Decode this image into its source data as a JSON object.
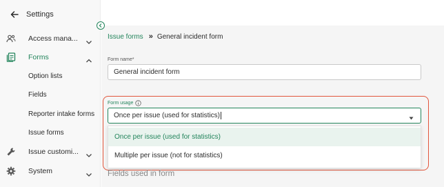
{
  "sidebar": {
    "title": "Settings",
    "items": [
      {
        "label": "Access mana...",
        "icon": "users-icon"
      },
      {
        "label": "Forms",
        "icon": "forms-icon"
      },
      {
        "label": "Issue customi...",
        "icon": "wrench-icon"
      },
      {
        "label": "System",
        "icon": "gear-icon"
      }
    ],
    "forms_children": [
      "Option lists",
      "Fields",
      "Reporter intake forms",
      "Issue forms"
    ]
  },
  "breadcrumb": {
    "parent": "Issue forms",
    "separator": "»",
    "current": "General incident form"
  },
  "form": {
    "name_label": "Form name*",
    "name_value": "General incident form",
    "usage_label": "Form usage",
    "usage_value": "Once per issue (used for statistics)",
    "usage_options": [
      "Once per issue (used for statistics)",
      "Multiple per issue (not for statistics)"
    ]
  },
  "section": {
    "fields_title": "Fields used in form"
  },
  "colors": {
    "accent": "#22845b",
    "highlight": "#e2553b",
    "selected_bg": "#e9f3ee"
  }
}
